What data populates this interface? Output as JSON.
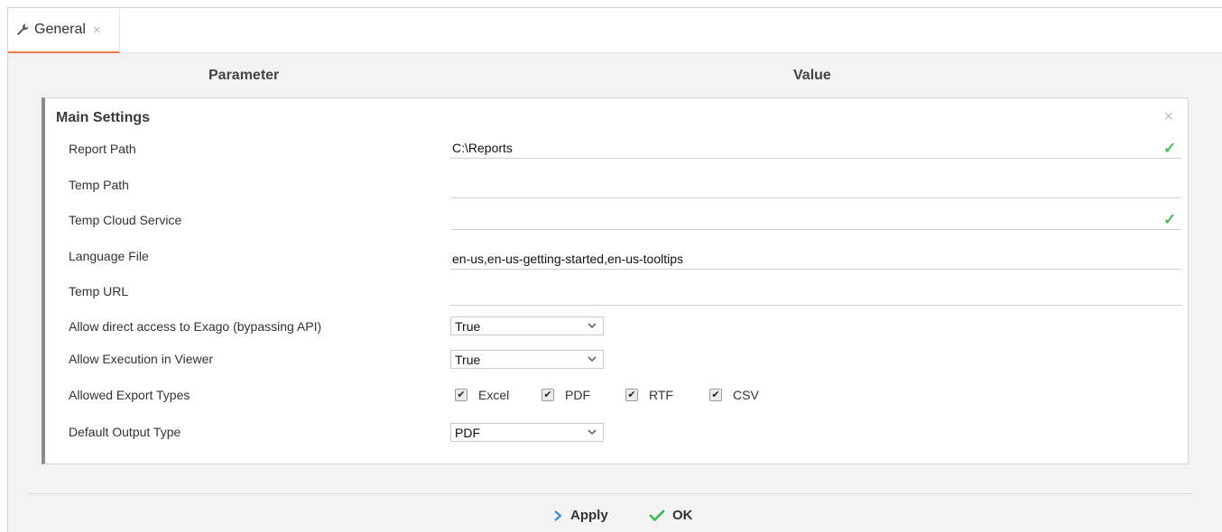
{
  "tab": {
    "label": "General",
    "close": "×"
  },
  "headers": {
    "parameter": "Parameter",
    "value": "Value"
  },
  "panel": {
    "title": "Main Settings",
    "close": "×"
  },
  "fields": {
    "report_path": {
      "label": "Report Path",
      "value": "C:\\Reports"
    },
    "temp_path": {
      "label": "Temp Path",
      "value": ""
    },
    "temp_cloud_service": {
      "label": "Temp Cloud Service",
      "value": ""
    },
    "language_file": {
      "label": "Language File",
      "value": "en-us,en-us-getting-started,en-us-tooltips"
    },
    "temp_url": {
      "label": "Temp URL",
      "value": ""
    },
    "allow_direct_access": {
      "label": "Allow direct access to Exago (bypassing API)",
      "value": "True"
    },
    "allow_execution": {
      "label": "Allow Execution in Viewer",
      "value": "True"
    },
    "export_types": {
      "label": "Allowed Export Types",
      "options": [
        {
          "label": "Excel",
          "checked": true
        },
        {
          "label": "PDF",
          "checked": true
        },
        {
          "label": "RTF",
          "checked": true
        },
        {
          "label": "CSV",
          "checked": true
        }
      ]
    },
    "default_output": {
      "label": "Default Output Type",
      "value": "PDF"
    }
  },
  "footer": {
    "apply": "Apply",
    "ok": "OK"
  },
  "colors": {
    "accent": "#ee7a4a",
    "success": "#4cb85c",
    "apply_arrow": "#4a90c8"
  },
  "icons": {
    "tab": "wrench-icon",
    "valid": "checkmark-icon",
    "apply": "chevron-right-icon",
    "ok": "checkmark-icon"
  }
}
